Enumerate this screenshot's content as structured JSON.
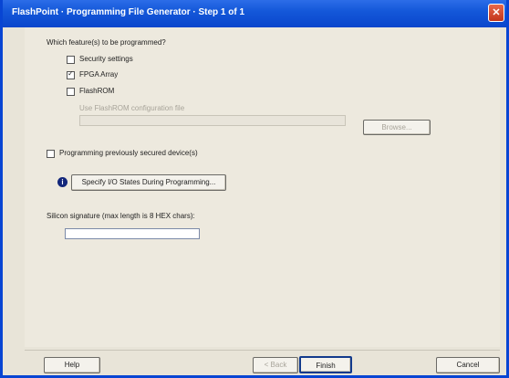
{
  "window": {
    "title": "FlashPoint · Programming File Generator · Step 1 of 1"
  },
  "section1": {
    "heading": "Which feature(s) to be programmed?",
    "options": [
      {
        "label": "Security settings",
        "checked": false
      },
      {
        "label": "FPGA Array",
        "checked": true
      },
      {
        "label": "FlashROM",
        "checked": false
      }
    ],
    "path_label": "Use FlashROM configuration file",
    "path_value": "",
    "browse_label": "Browse..."
  },
  "previously_secured": {
    "label": "Programming previously secured device(s)",
    "checked": false
  },
  "specify_button": {
    "label": "Specify I/O States During Programming..."
  },
  "silicon_signature": {
    "label": "Silicon signature (max length is 8 HEX chars):",
    "value": ""
  },
  "footer": {
    "help": "Help",
    "back": "< Back",
    "finish": "Finish",
    "cancel": "Cancel"
  }
}
